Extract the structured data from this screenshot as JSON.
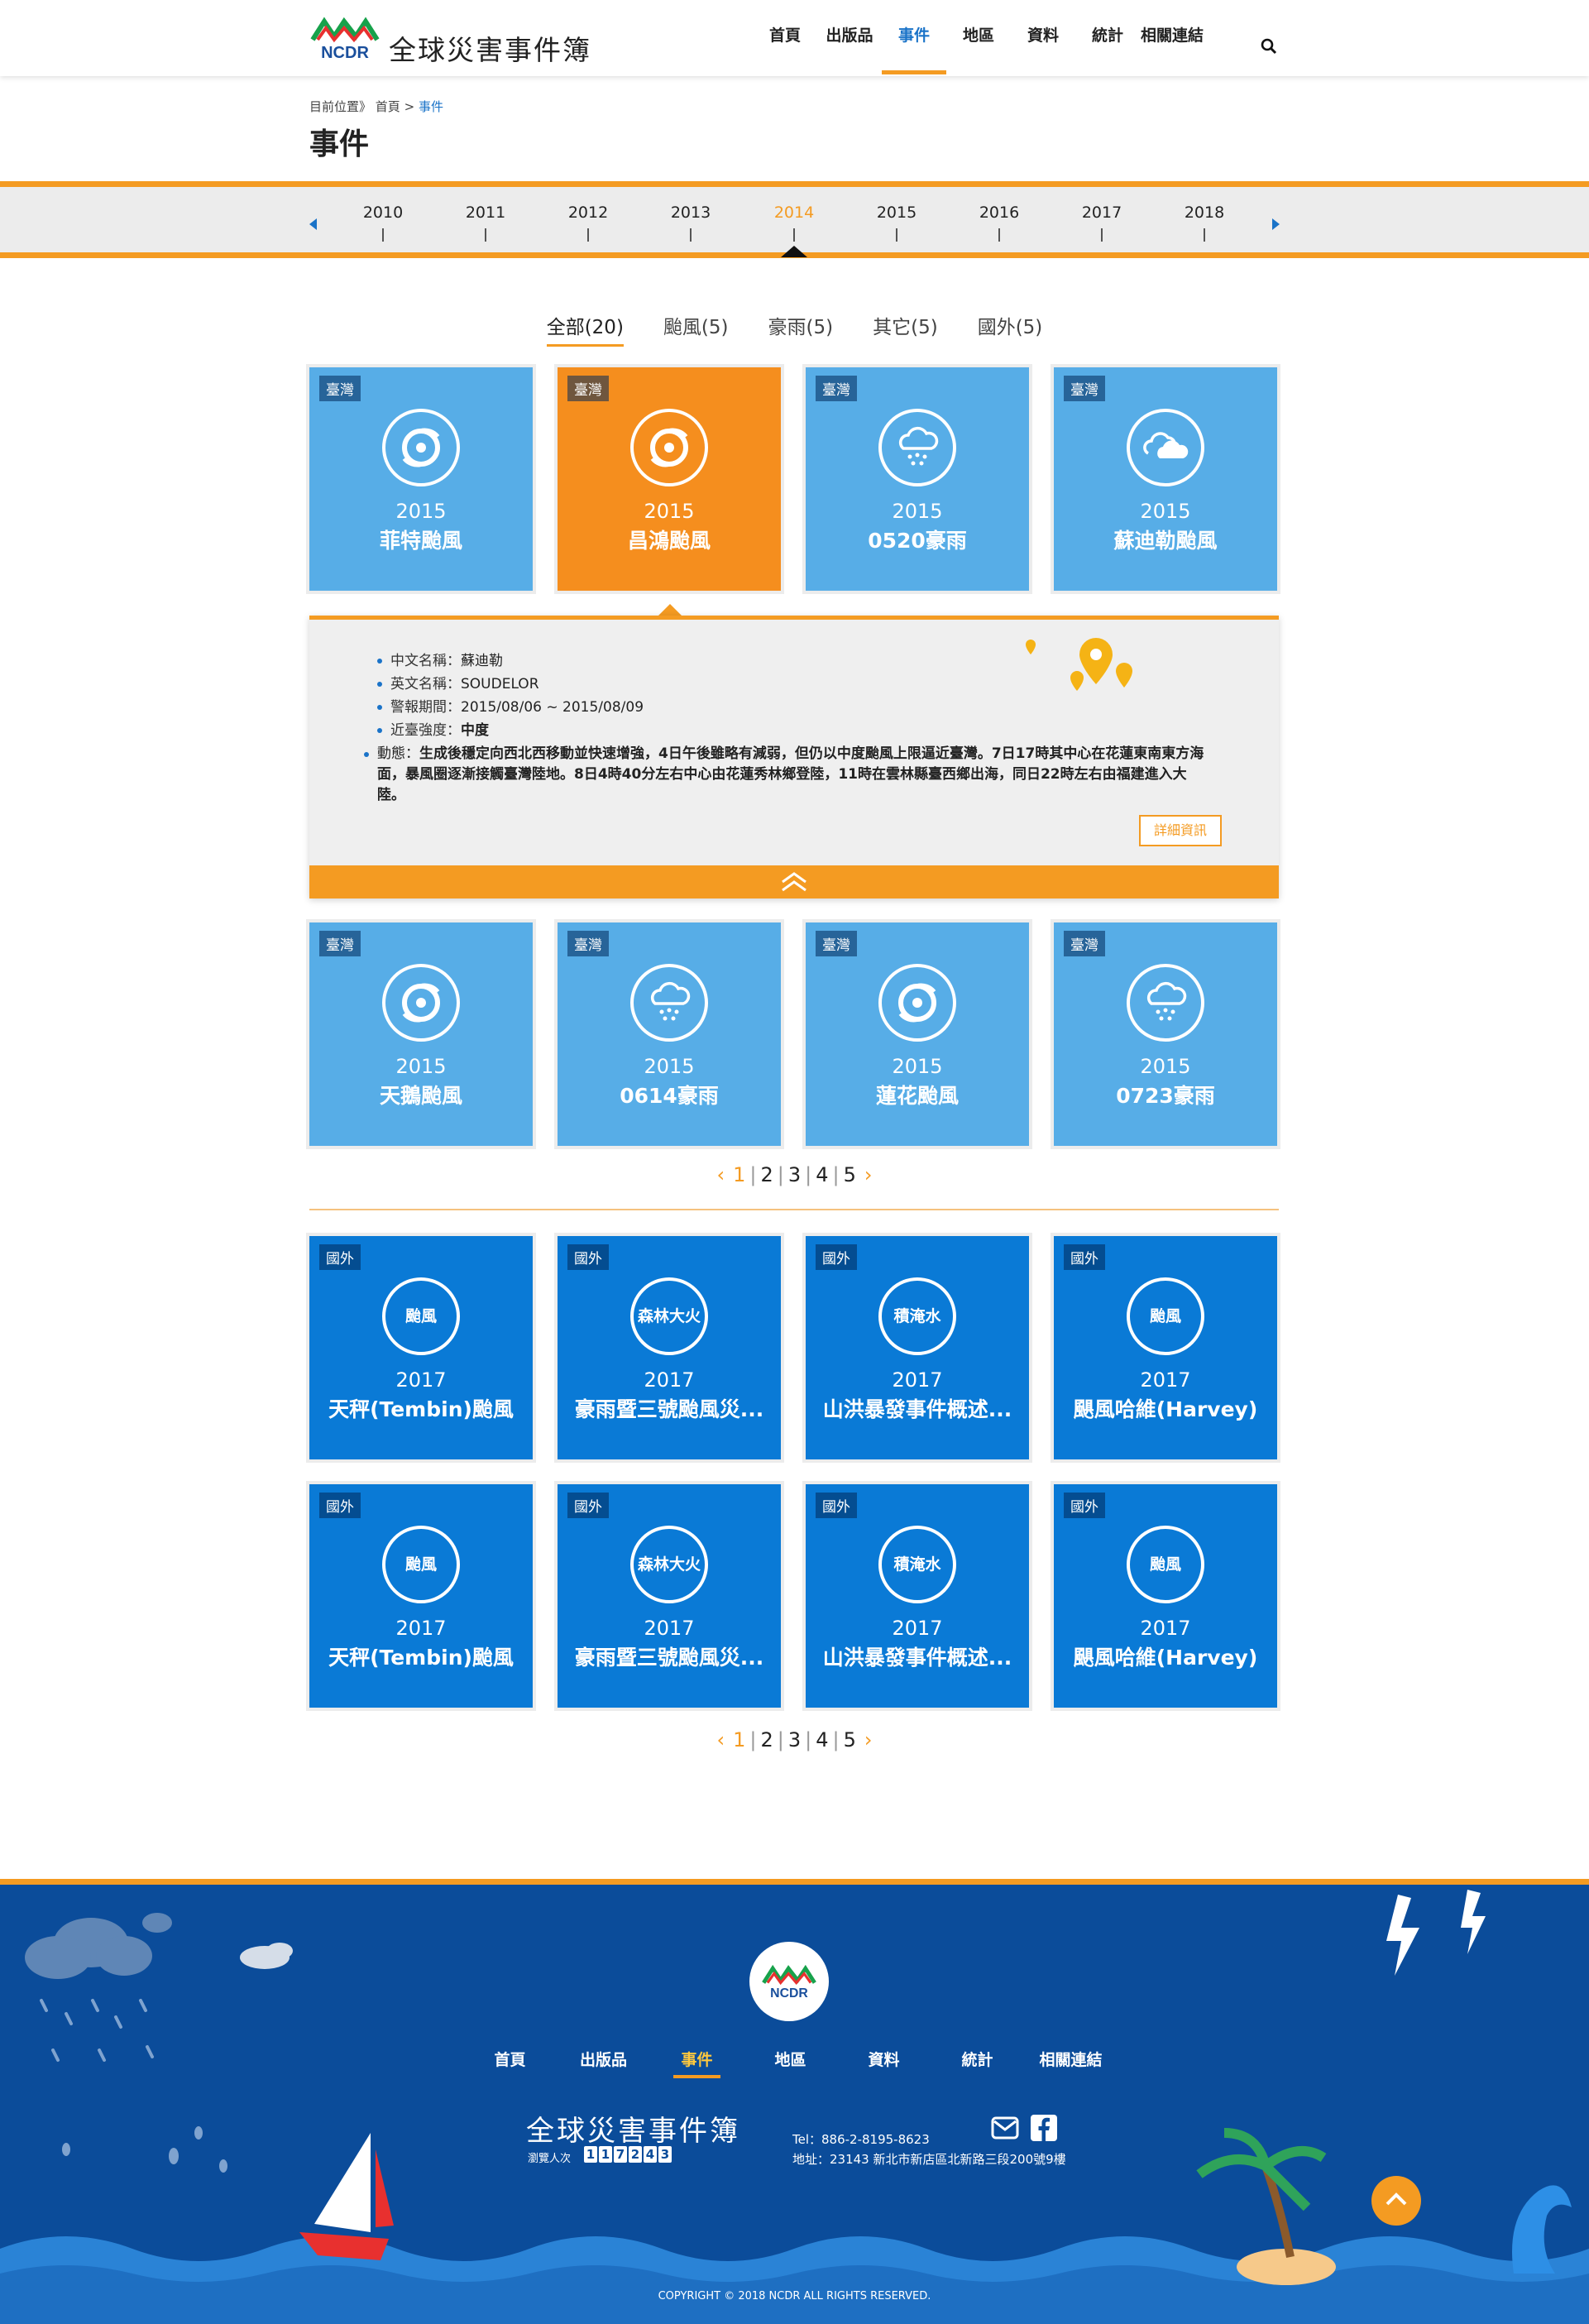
{
  "header": {
    "logo_text": "NCDR",
    "site_title": "全球災害事件簿",
    "nav": [
      "首頁",
      "出版品",
      "事件",
      "地區",
      "資料",
      "統計",
      "相關連結"
    ],
    "nav_active": "事件"
  },
  "breadcrumb": {
    "here": "目前位置》",
    "home": "首頁",
    "sep": ">",
    "current": "事件"
  },
  "page_title": "事件",
  "timeline": {
    "years": [
      "2010",
      "2011",
      "2012",
      "2013",
      "2014",
      "2015",
      "2016",
      "2017",
      "2018"
    ],
    "active": "2014"
  },
  "filters": [
    {
      "label": "全部(20)"
    },
    {
      "label": "颱風(5)"
    },
    {
      "label": "豪雨(5)"
    },
    {
      "label": "其它(5)"
    },
    {
      "label": "國外(5)"
    }
  ],
  "events_row1": [
    {
      "tag": "臺灣",
      "icon": "typhoon-icon",
      "year": "2015",
      "name": "菲特颱風"
    },
    {
      "tag": "臺灣",
      "icon": "typhoon-icon",
      "year": "2015",
      "name": "昌鴻颱風"
    },
    {
      "tag": "臺灣",
      "icon": "rain-cloud-icon",
      "year": "2015",
      "name": "0520豪雨"
    },
    {
      "tag": "臺灣",
      "icon": "storm-cloud-icon",
      "year": "2015",
      "name": "蘇迪勒颱風"
    }
  ],
  "detail": {
    "cn_label": "中文名稱：",
    "cn_value": "蘇迪勒",
    "en_label": "英文名稱：",
    "en_value": "SOUDELOR",
    "period_label": "警報期間：",
    "period_value": "2015/08/06 ~ 2015/08/09",
    "strength_label": "近臺強度：",
    "strength_value": "中度",
    "desc_label": "動態：",
    "desc_value": "生成後穩定向西北西移動並快速增強，4日午後雖略有減弱，但仍以中度颱風上限逼近臺灣。7日17時其中心在花蓮東南東方海面，暴風圈逐漸接觸臺灣陸地。8日4時40分左右中心由花蓮秀林鄉登陸，11時在雲林縣臺西鄉出海，同日22時左右由福建進入大陸。",
    "more_button": "詳細資訊"
  },
  "events_row2": [
    {
      "tag": "臺灣",
      "icon": "typhoon-icon",
      "year": "2015",
      "name": "天鵝颱風"
    },
    {
      "tag": "臺灣",
      "icon": "rain-cloud-icon",
      "year": "2015",
      "name": "0614豪雨"
    },
    {
      "tag": "臺灣",
      "icon": "typhoon-icon",
      "year": "2015",
      "name": "蓮花颱風"
    },
    {
      "tag": "臺灣",
      "icon": "rain-cloud-icon",
      "year": "2015",
      "name": "0723豪雨"
    }
  ],
  "pager": {
    "prev": "‹",
    "next": "›",
    "pages": [
      "1",
      "2",
      "3",
      "4",
      "5"
    ],
    "current": "1"
  },
  "foreign_row1": [
    {
      "tag": "國外",
      "type": "颱風",
      "year": "2017",
      "name": "天秤(Tembin)颱風"
    },
    {
      "tag": "國外",
      "type": "森林大火",
      "year": "2017",
      "name": "豪雨暨三號颱風災..."
    },
    {
      "tag": "國外",
      "type": "積淹水",
      "year": "2017",
      "name": "山洪暴發事件概述..."
    },
    {
      "tag": "國外",
      "type": "颱風",
      "year": "2017",
      "name": "颶風哈維(Harvey)"
    }
  ],
  "foreign_row2": [
    {
      "tag": "國外",
      "type": "颱風",
      "year": "2017",
      "name": "天秤(Tembin)颱風"
    },
    {
      "tag": "國外",
      "type": "森林大火",
      "year": "2017",
      "name": "豪雨暨三號颱風災..."
    },
    {
      "tag": "國外",
      "type": "積淹水",
      "year": "2017",
      "name": "山洪暴發事件概述..."
    },
    {
      "tag": "國外",
      "type": "颱風",
      "year": "2017",
      "name": "颶風哈維(Harvey)"
    }
  ],
  "footer": {
    "nav": [
      "首頁",
      "出版品",
      "事件",
      "地區",
      "資料",
      "統計",
      "相關連結"
    ],
    "nav_active": "事件",
    "title": "全球災害事件簿",
    "visit_label": "瀏覽人次",
    "visit_digits": [
      "1",
      "1",
      "7",
      "2",
      "4",
      "3"
    ],
    "tel": "Tel：886-2-8195-8623",
    "address": "地址：23143 新北市新店區北新路三段200號9樓",
    "copyright": "COPYRIGHT © 2018 NCDR ALL RIGHTS RESERVED."
  },
  "colors": {
    "accent": "#f49b22",
    "brand_blue": "#1a73c8",
    "card_light": "#57ade7",
    "card_dark": "#0a7ad6",
    "footer": "#0b4c9a"
  }
}
